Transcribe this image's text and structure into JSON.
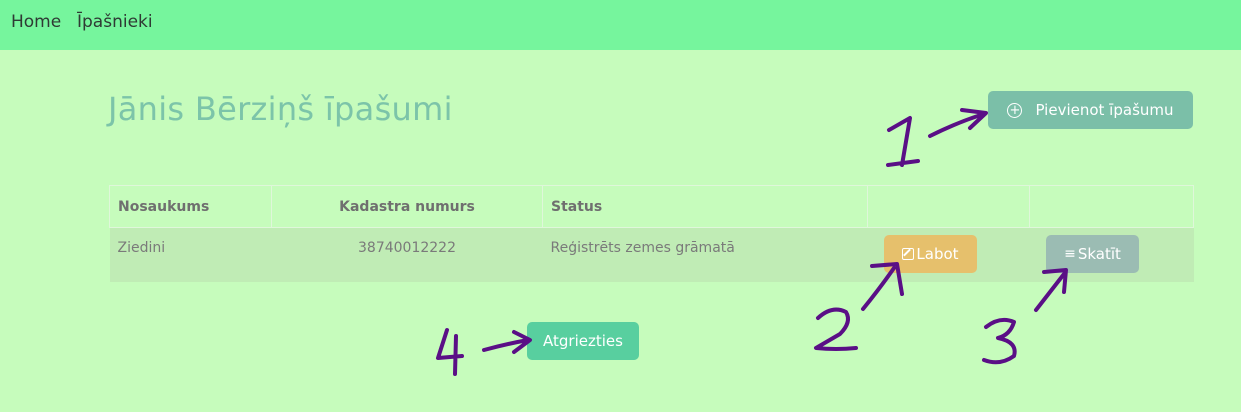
{
  "nav": {
    "home": "Home",
    "owners": "Īpašnieki"
  },
  "page": {
    "title": "Jānis Bērziņš īpašumi"
  },
  "buttons": {
    "add_property": "Pievienot īpašumu",
    "edit": "Labot",
    "view": "Skatīt",
    "back": "Atgriezties"
  },
  "table": {
    "headers": [
      "Nosaukums",
      "Kadastra numurs",
      "Status",
      "",
      ""
    ],
    "rows": [
      {
        "name": "Ziedini",
        "cadastre": "38740012222",
        "status": "Reģistrēts zemes grāmatā"
      }
    ]
  },
  "annotations": [
    "1",
    "2",
    "3",
    "4"
  ],
  "colors": {
    "background": "#c6fcbc",
    "navbar": "#76f59d",
    "title": "#7cc4a9",
    "add_button": "#7bbfa8",
    "edit_button": "#e6c06c",
    "view_button": "#9bbcb3",
    "back_button": "#58cf9f",
    "annotation_ink": "#5a0f86"
  },
  "icons": {
    "add": "plus-circle-icon",
    "edit": "edit-icon",
    "view": "list-icon"
  }
}
